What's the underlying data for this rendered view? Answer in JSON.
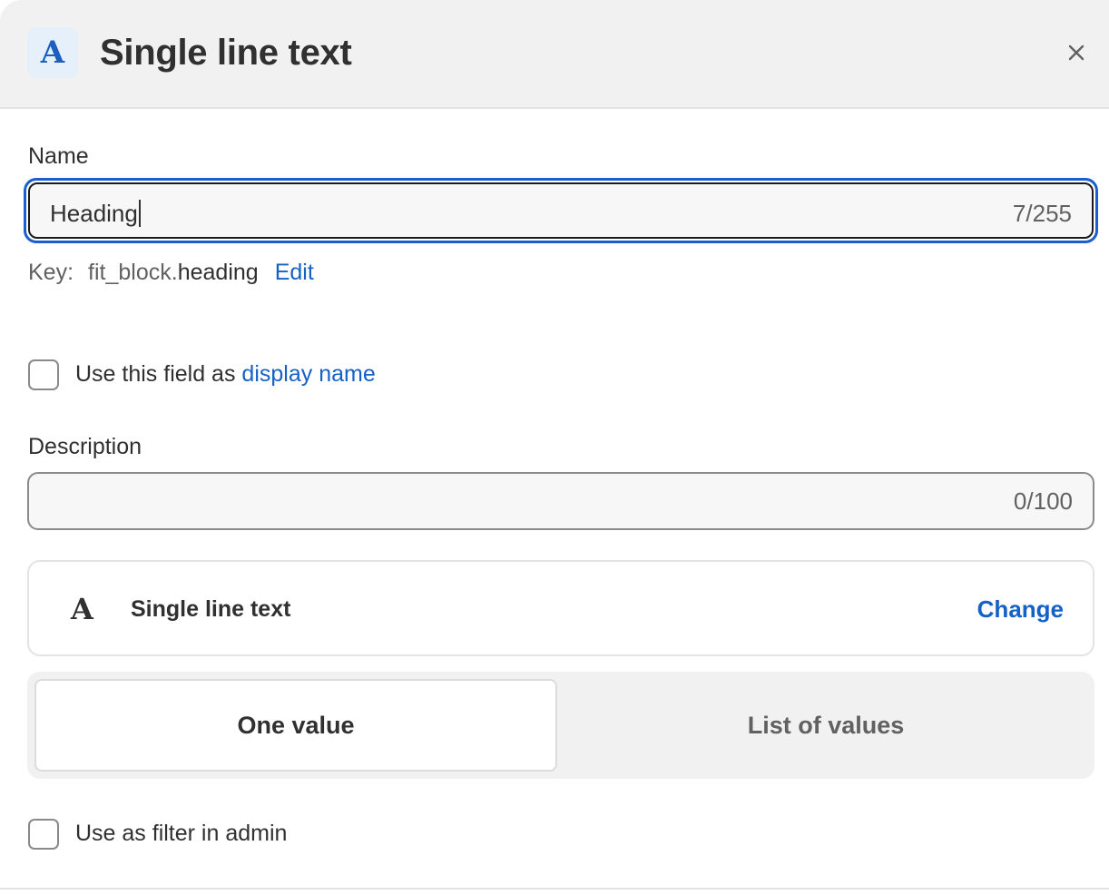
{
  "header": {
    "icon_glyph": "A",
    "icon_name": "text-type-icon",
    "title": "Single line text",
    "close_icon": "close-icon"
  },
  "name_field": {
    "label": "Name",
    "value": "Heading",
    "counter": "7/255"
  },
  "key": {
    "label": "Key:",
    "prefix": "fit_block.",
    "suffix": "heading",
    "edit_label": "Edit"
  },
  "display_name_option": {
    "checked": false,
    "text": "Use this field as ",
    "link_text": "display name"
  },
  "description_field": {
    "label": "Description",
    "value": "",
    "counter": "0/100"
  },
  "type_card": {
    "icon_glyph": "A",
    "type_name": "Single line text",
    "change_label": "Change"
  },
  "value_mode": {
    "selected": "one",
    "options": [
      {
        "id": "one",
        "label": "One value"
      },
      {
        "id": "list",
        "label": "List of values"
      }
    ]
  },
  "filter_option": {
    "checked": false,
    "text": "Use as filter in admin"
  },
  "colors": {
    "accent": "#1461c7",
    "focus_ring": "#1a5fcf",
    "header_bg": "#f1f1f1",
    "icon_bg": "#e6f0fb"
  }
}
